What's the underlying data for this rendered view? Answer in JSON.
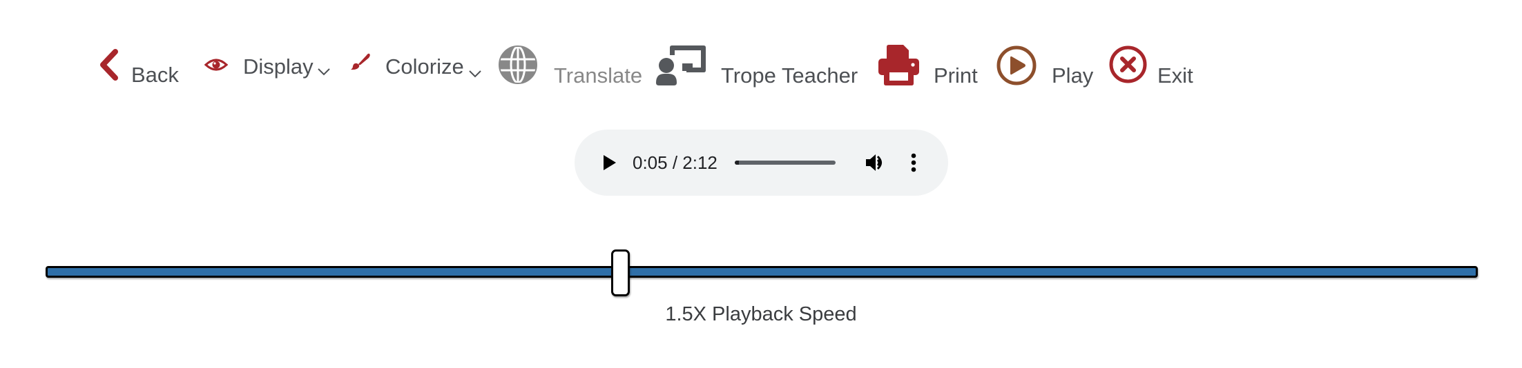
{
  "toolbar": {
    "back": {
      "label": "Back",
      "icon": "chevron-left-icon"
    },
    "display": {
      "label": "Display",
      "icon": "eye-icon",
      "has_dropdown": true
    },
    "colorize": {
      "label": "Colorize",
      "icon": "paintbrush-icon",
      "has_dropdown": true
    },
    "translate": {
      "label": "Translate",
      "icon": "globe-icon",
      "disabled": true
    },
    "trope_teacher": {
      "label": "Trope Teacher",
      "icon": "teacher-icon"
    },
    "print": {
      "label": "Print",
      "icon": "printer-icon"
    },
    "play": {
      "label": "Play",
      "icon": "play-circle-icon"
    },
    "exit": {
      "label": "Exit",
      "icon": "close-circle-icon"
    }
  },
  "colors": {
    "accent_red": "#a8262b",
    "play_brown": "#8d4f2c",
    "icon_gray": "#55585c",
    "disabled_gray": "#888888",
    "slider_blue": "#2f6fa8",
    "player_bg": "#f1f3f4"
  },
  "audio_player": {
    "current_time": "0:05",
    "duration": "2:12",
    "time_display": "0:05 / 2:12",
    "progress_fraction": 0.038,
    "play_icon": "play-icon",
    "volume_icon": "volume-icon",
    "menu_icon": "more-vert-icon"
  },
  "speed_slider": {
    "value_fraction": 0.4,
    "label": "1.5X Playback Speed"
  }
}
